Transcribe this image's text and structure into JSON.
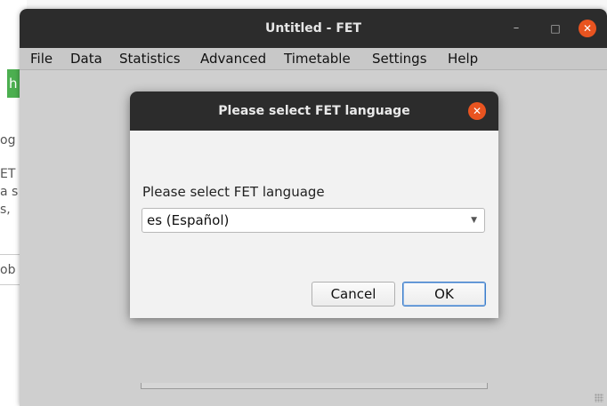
{
  "main_window": {
    "title": "Untitled - FET",
    "minimize_glyph": "–",
    "maximize_glyph": "□",
    "close_glyph": "✕"
  },
  "menubar": {
    "items": [
      "File",
      "Data",
      "Statistics",
      "Advanced",
      "Timetable",
      "Settings",
      "Help"
    ]
  },
  "background_fragments": {
    "green_button": "h",
    "text1": "og",
    "text2": "ET",
    "text3": "a s",
    "text4": "s,",
    "text5": "ob"
  },
  "dialog": {
    "title": "Please select FET language",
    "close_glyph": "✕",
    "label": "Please select FET language",
    "language_selected": "es (Español)",
    "dropdown_arrow": "▼",
    "cancel_label": "Cancel",
    "ok_label": "OK"
  },
  "colors": {
    "titlebar": "#2c2c2c",
    "close_button": "#e95420",
    "ok_focus": "#3d7ec9"
  }
}
